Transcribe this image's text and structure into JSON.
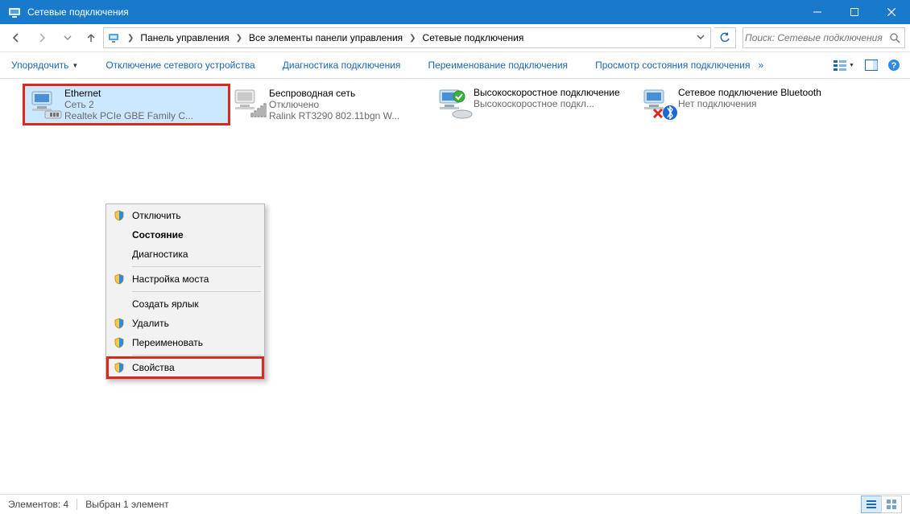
{
  "window": {
    "title": "Сетевые подключения"
  },
  "breadcrumbs": {
    "item0": "Панель управления",
    "item1": "Все элементы панели управления",
    "item2": "Сетевые подключения"
  },
  "search": {
    "placeholder": "Поиск: Сетевые подключения"
  },
  "toolbar": {
    "organize": "Упорядочить",
    "disable": "Отключение сетевого устройства",
    "diagnose": "Диагностика подключения",
    "rename": "Переименование подключения",
    "status": "Просмотр состояния подключения"
  },
  "connections": [
    {
      "name": "Ethernet",
      "status": "Сеть  2",
      "device": "Realtek PCIe GBE Family C..."
    },
    {
      "name": "Беспроводная сеть",
      "status": "Отключено",
      "device": "Ralink RT3290 802.11bgn W..."
    },
    {
      "name": "Высокоскоростное подключение",
      "status": "",
      "device": "Высокоскоростное подкл..."
    },
    {
      "name": "Сетевое подключение Bluetooth",
      "status": "",
      "device": "Нет подключения"
    }
  ],
  "contextmenu": {
    "items": [
      {
        "label": "Отключить",
        "shield": true
      },
      {
        "label": "Состояние",
        "bold": true
      },
      {
        "label": "Диагностика"
      },
      {
        "label": "Настройка моста",
        "shield": true
      },
      {
        "label": "Создать ярлык"
      },
      {
        "label": "Удалить",
        "shield": true
      },
      {
        "label": "Переименовать",
        "shield": true
      },
      {
        "label": "Свойства",
        "shield": true
      }
    ]
  },
  "statusbar": {
    "count_label": "Элементов: 4",
    "selection_label": "Выбран 1 элемент"
  }
}
